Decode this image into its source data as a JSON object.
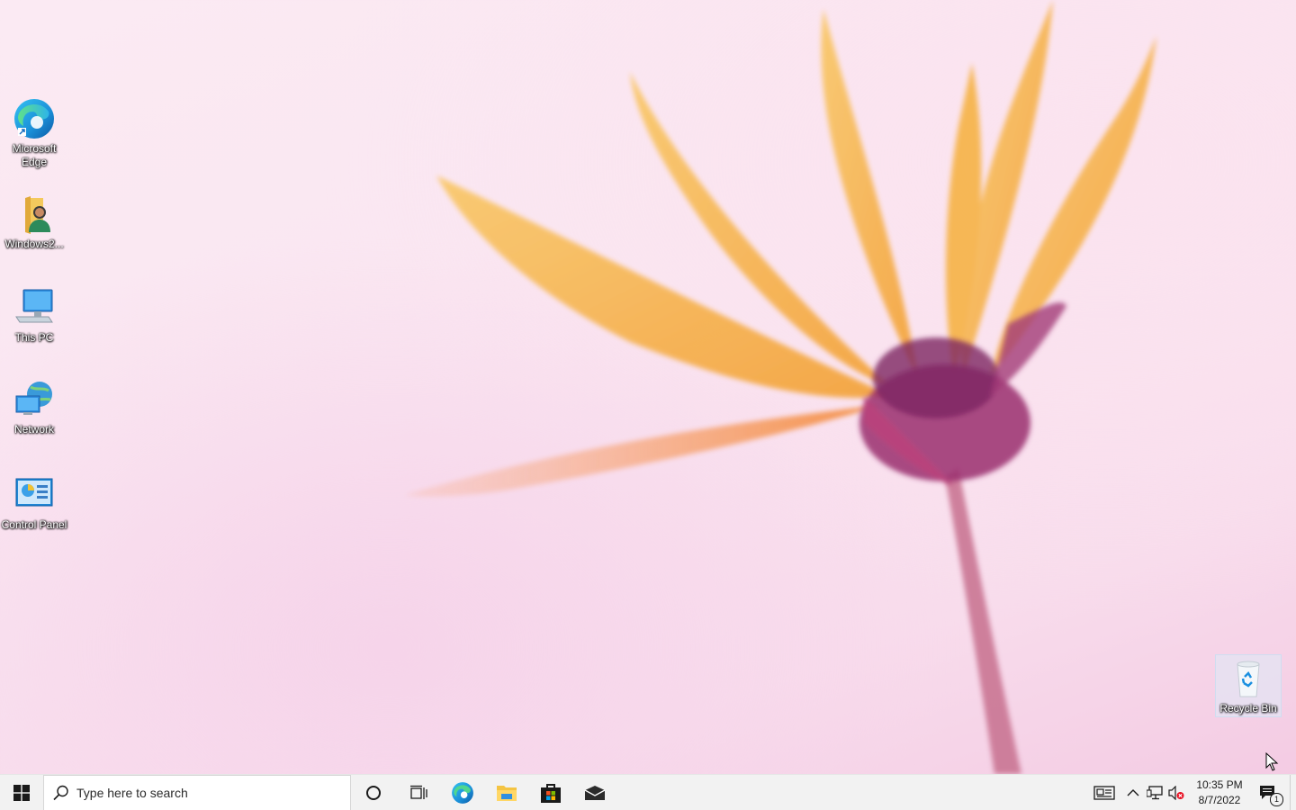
{
  "desktop": {
    "icons": [
      {
        "label": "Microsoft Edge",
        "icon": "edge-icon"
      },
      {
        "label": "Windows2...",
        "icon": "user-folder-icon"
      },
      {
        "label": "This PC",
        "icon": "computer-icon"
      },
      {
        "label": "Network",
        "icon": "network-icon"
      },
      {
        "label": "Control Panel",
        "icon": "control-panel-icon"
      },
      {
        "label": "Recycle Bin",
        "icon": "recycle-bin-icon"
      }
    ]
  },
  "taskbar": {
    "search_placeholder": "Type here to search",
    "pinned": [
      "cortana-icon",
      "task-view-icon",
      "edge-icon",
      "file-explorer-icon",
      "store-icon",
      "mail-icon"
    ],
    "clock": {
      "time": "10:35 PM",
      "date": "8/7/2022"
    },
    "notification_count": "1"
  },
  "colors": {
    "accent": "#0078d4",
    "taskbar": "#f2f2f2"
  }
}
